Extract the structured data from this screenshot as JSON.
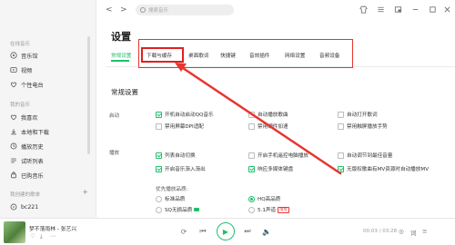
{
  "sidebar": {
    "section_online": "在线音乐",
    "online_items": [
      {
        "label": "音乐馆",
        "icon": "music-hall-icon"
      },
      {
        "label": "视频",
        "icon": "video-icon"
      },
      {
        "label": "个性电台",
        "icon": "radio-icon"
      }
    ],
    "section_mine": "我的音乐",
    "mine_items": [
      {
        "label": "我喜欢",
        "icon": "heart-icon"
      },
      {
        "label": "本地和下载",
        "icon": "download-icon"
      },
      {
        "label": "播放历史",
        "icon": "history-icon"
      },
      {
        "label": "试听列表",
        "icon": "list-icon"
      },
      {
        "label": "已购音乐",
        "icon": "purchased-icon"
      }
    ],
    "section_created": "我创建的歌单",
    "plus": "+",
    "playlist": {
      "label": "bc221",
      "icon": "playlist-icon"
    }
  },
  "topbar": {
    "back": "<",
    "forward": ">",
    "search_placeholder": "搜索音乐"
  },
  "settings": {
    "title": "设置",
    "tabs": [
      "常规设置",
      "下载与缓存",
      "桌面歌词",
      "快捷键",
      "音效插件",
      "网络设置",
      "音频设备"
    ],
    "section": "常规设置",
    "startup_label": "启动",
    "startup_options": [
      {
        "label": "开机自动启动QQ音乐",
        "checked": true
      },
      {
        "label": "自动播放歌曲",
        "checked": false
      },
      {
        "label": "自动打开歌词",
        "checked": false
      },
      {
        "label": "禁用屏幕DPI适配",
        "checked": false
      },
      {
        "label": "禁用硬件加速",
        "checked": false
      },
      {
        "label": "禁用触屏播放手势",
        "checked": false
      }
    ],
    "play_label": "播放",
    "play_options": [
      {
        "label": "列表自动切换",
        "checked": true
      },
      {
        "label": "开启手机遥控电脑播放",
        "checked": false
      },
      {
        "label": "自动调节到最佳音量",
        "checked": false
      },
      {
        "label": "开启音乐渐入渐出",
        "checked": true
      },
      {
        "label": "响应多媒体键盘",
        "checked": true
      },
      {
        "label": "无版权歌曲有MV资源时自动播放MV",
        "checked": true
      }
    ],
    "quality_title": "优先播放品质:",
    "quality_options": [
      {
        "label": "标准品质",
        "selected": false
      },
      {
        "label": "HQ高品质",
        "selected": true
      },
      {
        "label": "SQ无损品质",
        "selected": false
      },
      {
        "label": "5.1声道",
        "selected": false,
        "badge": "限免"
      }
    ]
  },
  "player": {
    "song": "梦不落雨林 - 张艺兴",
    "time": "00:03 / 03:28",
    "play_icon": "▶"
  }
}
